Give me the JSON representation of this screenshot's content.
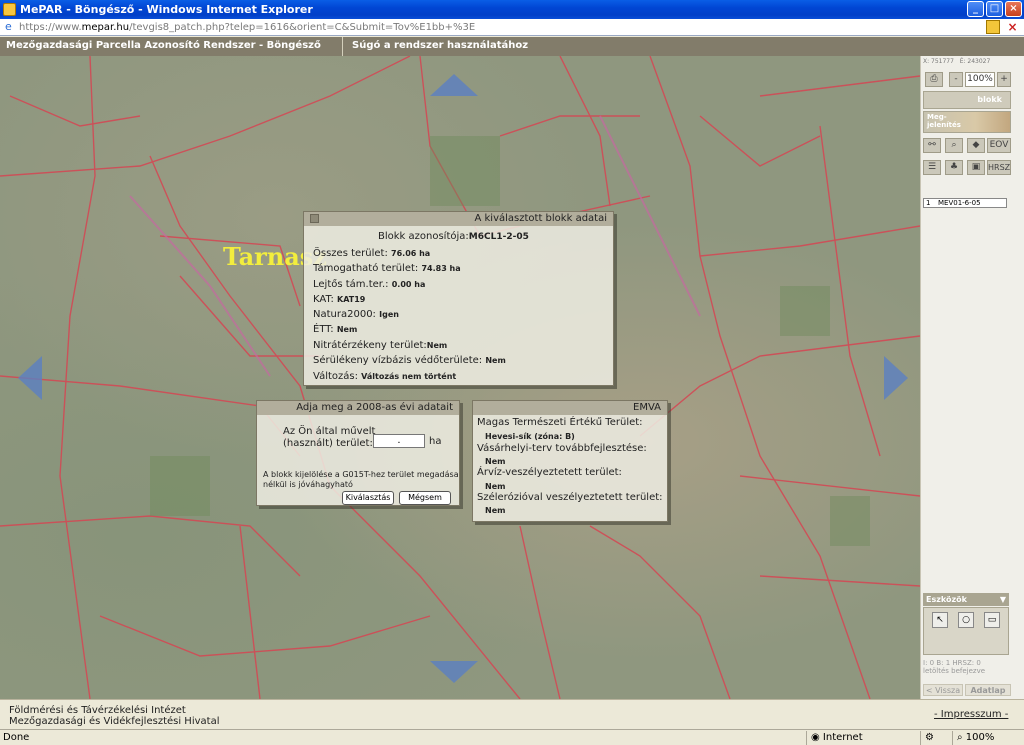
{
  "window": {
    "title": "MePAR - Böngésző - Windows Internet Explorer",
    "url_prefix": "https://www.",
    "url_host": "mepar.hu",
    "url_rest": "/tevgis8_patch.php?telep=1616&orient=C&Submit=Tov%E1bb+%3E"
  },
  "app_header": {
    "title": "Mezőgazdasági Parcella Azonosító Rendszer - Böngésző",
    "help": "Súgó a rendszer használatához"
  },
  "map": {
    "place_label": "Tarnasz"
  },
  "block_panel": {
    "title": "A kiválasztott blokk adatai",
    "id_label": "Blokk azonosítója:",
    "id_value": "M6CL1-2-05",
    "rows": [
      {
        "label": "Összes terület:",
        "value": "76.06 ha"
      },
      {
        "label": "Támogatható terület:",
        "value": "74.83 ha"
      },
      {
        "label": "Lejtős tám.ter.:",
        "value": "0.00 ha"
      },
      {
        "label": "KAT:",
        "value": "KAT19"
      },
      {
        "label": "Natura2000:",
        "value": "Igen"
      },
      {
        "label": "ÉTT:",
        "value": "Nem"
      },
      {
        "label": "Nitrátérzékeny terület:",
        "value": "Nem"
      },
      {
        "label": "Sérülékeny vízbázis védőterülete:",
        "value": "Nem"
      },
      {
        "label": "Változás:",
        "value": "Változás nem történt"
      }
    ]
  },
  "input_panel": {
    "title": "Adja meg a 2008-as évi adatait",
    "field_label_1": "Az Ön által művelt",
    "field_label_2": "(használt) terület:",
    "field_value": ".",
    "unit": "ha",
    "note": "A blokk kijelölése a G015T-hez terület megadása nélkül is jóváhagyható",
    "select_button": "Kiválasztás",
    "cancel_button": "Mégsem"
  },
  "emva_panel": {
    "title": "EMVA",
    "rows": [
      {
        "label": "Magas Természeti Értékű Terület:",
        "value": "Hevesi-sík (zóna: B)"
      },
      {
        "label": "Vásárhelyi-terv továbbfejlesztése:",
        "value": "Nem"
      },
      {
        "label": "Árvíz-veszélyeztetett terület:",
        "value": "Nem"
      },
      {
        "label": "Szélerózióval veszélyeztetett terület:",
        "value": "Nem"
      }
    ]
  },
  "sidebar": {
    "coord_x": "X: 751777",
    "coord_y": "É: 243027",
    "zoom": "100%",
    "blokk_button": "blokk",
    "megjelenites": "Meg-\njelenítés",
    "eov_button": "EOV",
    "hrsz_button": "HRSZ",
    "list_num": "1",
    "list_value": "MEV01-6-05",
    "tools_title": "Eszközök",
    "stats_1": "I: 0   B: 1   HRSZ: 0",
    "stats_2": "letöltés befejezve",
    "back": "< Vissza",
    "data_sheet": "Adatlap >"
  },
  "footer": {
    "line1": "Földmérési és Távérzékelési Intézet",
    "line2": "Mezőgazdasági és Vidékfejlesztési Hivatal",
    "impressum": "- Impresszum -"
  },
  "statusbar": {
    "done": "Done",
    "zone": "Internet",
    "zoom": "100%"
  }
}
